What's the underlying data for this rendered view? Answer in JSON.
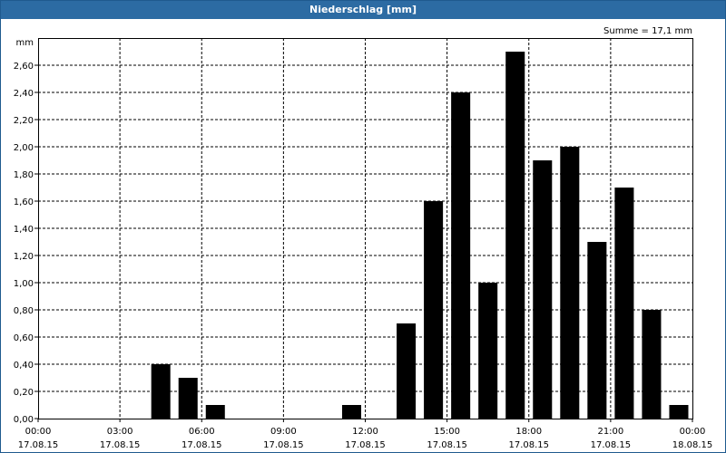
{
  "window": {
    "title": "Niederschlag [mm]"
  },
  "chart_data": {
    "type": "bar",
    "title": "Niederschlag [mm]",
    "ylabel": "mm",
    "annotation": "Summe = 17,1 mm",
    "ylim": [
      0,
      2.8
    ],
    "xlim_hours": [
      0,
      24
    ],
    "grid": true,
    "bar_color": "#000000",
    "grid_color": "#000000",
    "y_ticks": [
      "0,00",
      "0,20",
      "0,40",
      "0,60",
      "0,80",
      "1,00",
      "1,20",
      "1,40",
      "1,60",
      "1,80",
      "2,00",
      "2,20",
      "2,40",
      "2,60"
    ],
    "x_ticks": [
      {
        "time": "00:00",
        "date": "17.08.15"
      },
      {
        "time": "03:00",
        "date": "17.08.15"
      },
      {
        "time": "06:00",
        "date": "17.08.15"
      },
      {
        "time": "09:00",
        "date": "17.08.15"
      },
      {
        "time": "12:00",
        "date": "17.08.15"
      },
      {
        "time": "15:00",
        "date": "17.08.15"
      },
      {
        "time": "18:00",
        "date": "17.08.15"
      },
      {
        "time": "21:00",
        "date": "17.08.15"
      },
      {
        "time": "00:00",
        "date": "18.08.15"
      }
    ],
    "series": [
      {
        "points": [
          {
            "x": "04:00",
            "y": 0.4
          },
          {
            "x": "05:00",
            "y": 0.3
          },
          {
            "x": "06:00",
            "y": 0.1
          },
          {
            "x": "11:00",
            "y": 0.1
          },
          {
            "x": "13:00",
            "y": 0.7
          },
          {
            "x": "14:00",
            "y": 1.6
          },
          {
            "x": "15:00",
            "y": 2.4
          },
          {
            "x": "16:00",
            "y": 1.0
          },
          {
            "x": "17:00",
            "y": 2.7
          },
          {
            "x": "18:00",
            "y": 1.9
          },
          {
            "x": "19:00",
            "y": 2.0
          },
          {
            "x": "20:00",
            "y": 1.3
          },
          {
            "x": "21:00",
            "y": 1.7
          },
          {
            "x": "22:00",
            "y": 0.8
          },
          {
            "x": "23:00",
            "y": 0.1
          }
        ]
      }
    ]
  }
}
